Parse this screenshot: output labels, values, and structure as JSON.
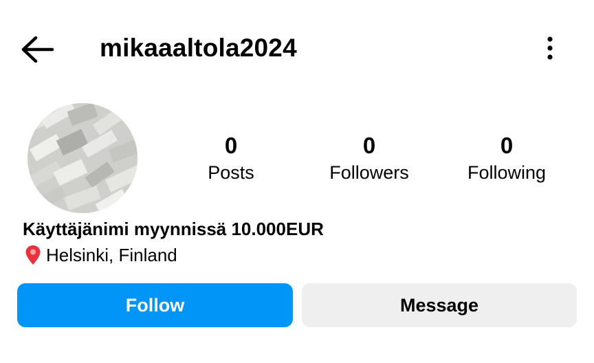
{
  "header": {
    "username": "mikaaaltola2024",
    "back_icon": "arrow-left-icon",
    "more_icon": "more-vertical-icon"
  },
  "profile": {
    "avatar": "profile-picture",
    "stats": [
      {
        "count": "0",
        "label": "Posts"
      },
      {
        "count": "0",
        "label": "Followers"
      },
      {
        "count": "0",
        "label": "Following"
      }
    ],
    "bio_name": "Käyttäjänimi myynnissä 10.000EUR",
    "location_icon": "pin-icon",
    "location": "Helsinki, Finland"
  },
  "actions": {
    "follow_label": "Follow",
    "message_label": "Message"
  },
  "colors": {
    "follow_bg": "#0095f6",
    "message_bg": "#efefef",
    "pin": "#e8333e"
  }
}
